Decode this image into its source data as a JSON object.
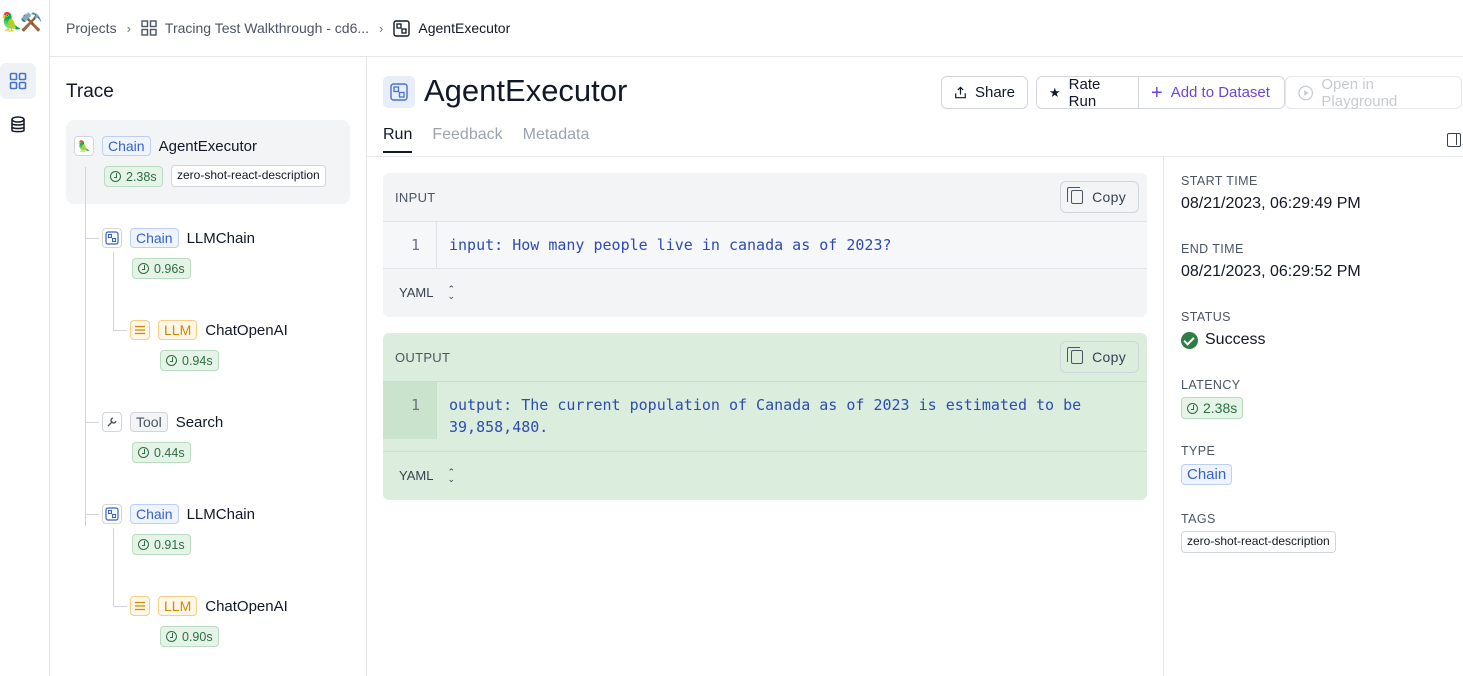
{
  "breadcrumb": {
    "projects": "Projects",
    "project": "Tracing Test Walkthrough - cd6...",
    "run": "AgentExecutor"
  },
  "trace": {
    "title": "Trace",
    "nodes": [
      {
        "type": "Chain",
        "name": "AgentExecutor",
        "latency": "2.38s",
        "tag": "zero-shot-react-description"
      },
      {
        "type": "Chain",
        "name": "LLMChain",
        "latency": "0.96s"
      },
      {
        "type": "LLM",
        "name": "ChatOpenAI",
        "latency": "0.94s"
      },
      {
        "type": "Tool",
        "name": "Search",
        "latency": "0.44s"
      },
      {
        "type": "Chain",
        "name": "LLMChain",
        "latency": "0.91s"
      },
      {
        "type": "LLM",
        "name": "ChatOpenAI",
        "latency": "0.90s"
      }
    ]
  },
  "main": {
    "title": "AgentExecutor",
    "buttons": {
      "share": "Share",
      "rate": "Rate Run",
      "add_dataset": "Add to Dataset",
      "playground": "Open in Playground"
    },
    "tabs": [
      "Run",
      "Feedback",
      "Metadata"
    ],
    "input": {
      "label": "INPUT",
      "copy": "Copy",
      "line_no": "1",
      "code": "input: How many people live in canada as of 2023?",
      "format": "YAML"
    },
    "output": {
      "label": "OUTPUT",
      "copy": "Copy",
      "line_no": "1",
      "code_line1": "output: The current population of Canada as of 2023 is estimated to be",
      "code_line2": "39,858,480.",
      "format": "YAML"
    }
  },
  "details": {
    "start_label": "START TIME",
    "start_value": "08/21/2023, 06:29:49 PM",
    "end_label": "END TIME",
    "end_value": "08/21/2023, 06:29:52 PM",
    "status_label": "STATUS",
    "status_value": "Success",
    "latency_label": "LATENCY",
    "latency_value": "2.38s",
    "type_label": "TYPE",
    "type_value": "Chain",
    "tags_label": "TAGS",
    "tag_value": "zero-shot-react-description"
  },
  "icons": {
    "logo": "parrot-and-tools-logo",
    "projects": "grid-icon",
    "datasets": "database-icon",
    "chain": "chain-icon",
    "llm": "llm-icon",
    "tool": "wrench-icon"
  },
  "colors": {
    "chain": "#3563c9",
    "llm": "#d38a00",
    "success": "#2f7d45",
    "output_bg": "#dbeedd",
    "accent_purple": "#6d44d9"
  }
}
